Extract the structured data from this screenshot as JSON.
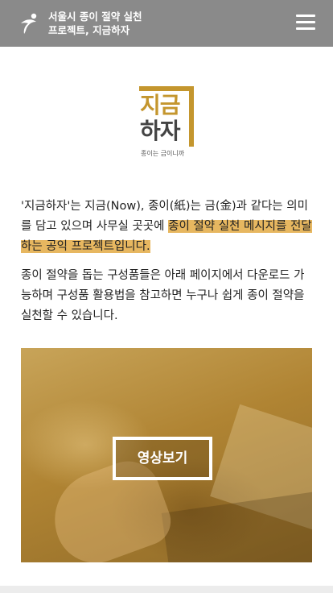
{
  "header": {
    "title_line1": "서울시 종이 절약 실천",
    "title_line2": "프로젝트, 지금하자",
    "logo_icon": "seoul-logo-icon",
    "menu_icon": "hamburger-menu-icon"
  },
  "brand": {
    "line1": "지금",
    "line2": "하자",
    "tagline": "종이는 금이니까",
    "accent_color": "#c4962e"
  },
  "intro": {
    "p1_part1": "'지금하자'는 지금(Now), 종이(紙)는 금(金)과 같다는 의미를 담고 있으며 사무실 곳곳에",
    "p1_highlight": "종이 절약 실천 메시지를 전달하는 공익 프로젝트입니다.",
    "p2": "종이 절약을 돕는 구성품들은 아래 페이지에서 다운로드 가능하며 구성품 활용법을 참고하면 누구나 쉽게 종이 절약을 실천할 수 있습니다."
  },
  "video": {
    "button_label": "영상보기",
    "highlight_color": "#e7b760"
  }
}
